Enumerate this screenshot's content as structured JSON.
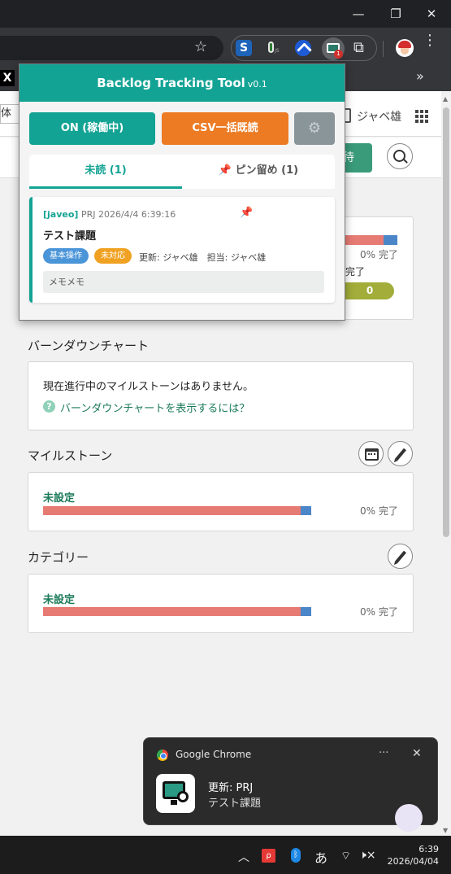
{
  "window": {
    "minimize": "—",
    "maximize": "❐",
    "close": "✕"
  },
  "toolbar": {
    "star": "☆",
    "ext_s": "S",
    "ext_js_sub": "JS",
    "ext_badge": "1",
    "puzzle": "⧉",
    "more": "⋮"
  },
  "bookmarks": {
    "x_logo": "X",
    "more": "»"
  },
  "page": {
    "header_left_text": "体カ",
    "header_user": "ジャベ雄",
    "green_button_text": "待",
    "status": {
      "percent": "0% 完了",
      "done_label": "完了",
      "done_count": "0"
    },
    "burndown": {
      "title": "バーンダウンチャート",
      "message": "現在進行中のマイルストーンはありません。",
      "help_icon": "?",
      "help_link": "バーンダウンチャートを表示するには？"
    },
    "milestone": {
      "title": "マイルストーン",
      "label": "未設定",
      "percent": "0% 完了",
      "completed_fraction": 0.04
    },
    "category": {
      "title": "カテゴリー",
      "label": "未設定",
      "percent": "0% 完了",
      "completed_fraction": 0.04
    }
  },
  "popup": {
    "title": "Backlog Tracking Tool",
    "version": "v0.1",
    "on_button": "ON (稼働中)",
    "csv_button": "CSV一括既読",
    "gear": "⚙",
    "tabs": {
      "unread": "未読 (1)",
      "pinned_icon": "📌",
      "pinned": "ピン留め (1)"
    },
    "issue": {
      "user": "[javeo]",
      "meta": "PRJ 2026/4/4 6:39:16",
      "pin": "📌",
      "title": "テスト課題",
      "tag_category": "基本操作",
      "tag_status": "未対応",
      "info": "更新: ジャベ雄　担当: ジャベ雄",
      "memo": "メモメモ"
    }
  },
  "toast": {
    "app": "Google Chrome",
    "more": "···",
    "close": "✕",
    "line1": "更新: PRJ",
    "line2": "テスト課題"
  },
  "taskbar": {
    "caret": "︿",
    "app_red": "ρ",
    "bluetooth": "ᛒ",
    "ime": "あ",
    "wifi": "⌔",
    "volume": "🕨×",
    "time": "6:39",
    "date": "2026/04/04"
  },
  "colors": {
    "accent": "#13a394",
    "csv": "#ec7b24",
    "progress_todo": "#e67b74",
    "progress_done": "#4a86c8"
  }
}
